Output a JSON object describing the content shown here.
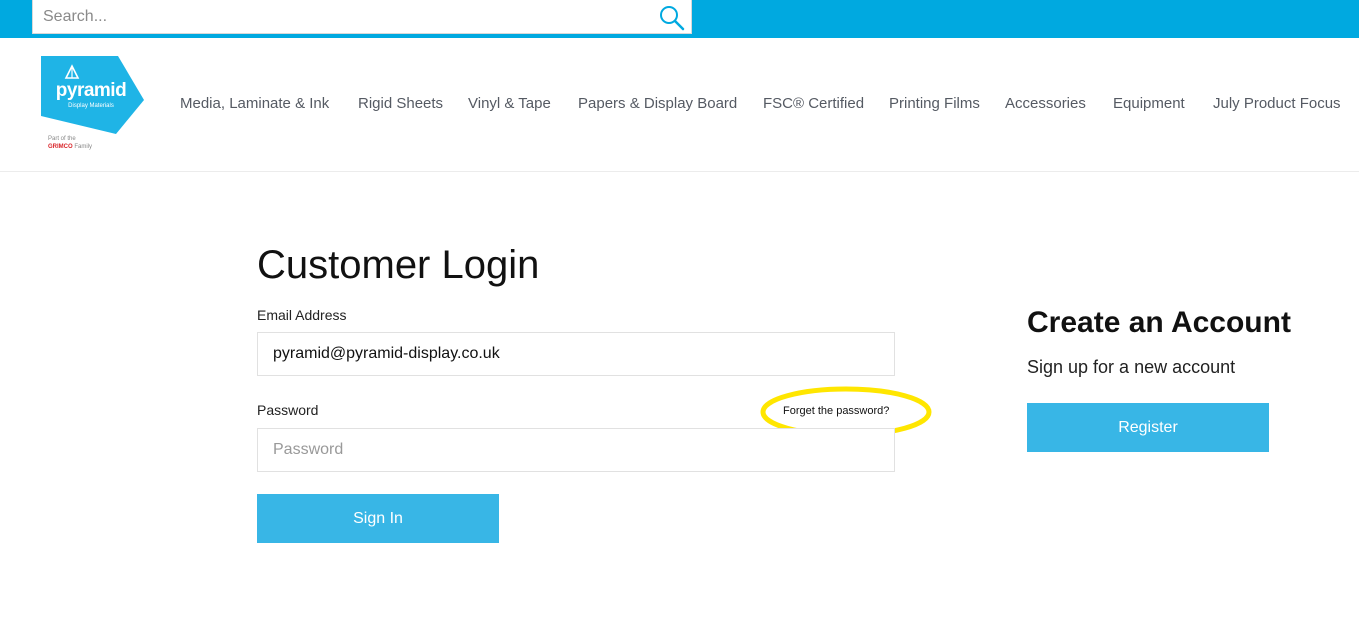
{
  "search": {
    "placeholder": "Search...",
    "icon": "search-icon"
  },
  "brand": {
    "name": "pyramid",
    "tagline": "Display Materials",
    "part_of": "Part of the",
    "group": "GRIMCO",
    "family": "Family",
    "colors": {
      "primary": "#00a9e0",
      "button": "#38b6e6",
      "accent": "#d9262b"
    }
  },
  "nav": {
    "items": [
      {
        "label": "Media, Laminate & Ink"
      },
      {
        "label": "Rigid Sheets"
      },
      {
        "label": "Vinyl & Tape"
      },
      {
        "label": "Papers & Display Board"
      },
      {
        "label": "FSC® Certified"
      },
      {
        "label": "Printing Films"
      },
      {
        "label": "Accessories"
      },
      {
        "label": "Equipment"
      },
      {
        "label": "July Product Focus"
      }
    ]
  },
  "login": {
    "title": "Customer Login",
    "email_label": "Email Address",
    "email_value": "pyramid@pyramid-display.co.uk",
    "password_label": "Password",
    "password_placeholder": "Password",
    "forgot_label": "Forget the password?",
    "signin_label": "Sign In",
    "highlight_color": "#ffe600"
  },
  "register": {
    "title": "Create an Account",
    "subtitle": "Sign up for a new account",
    "button_label": "Register"
  }
}
